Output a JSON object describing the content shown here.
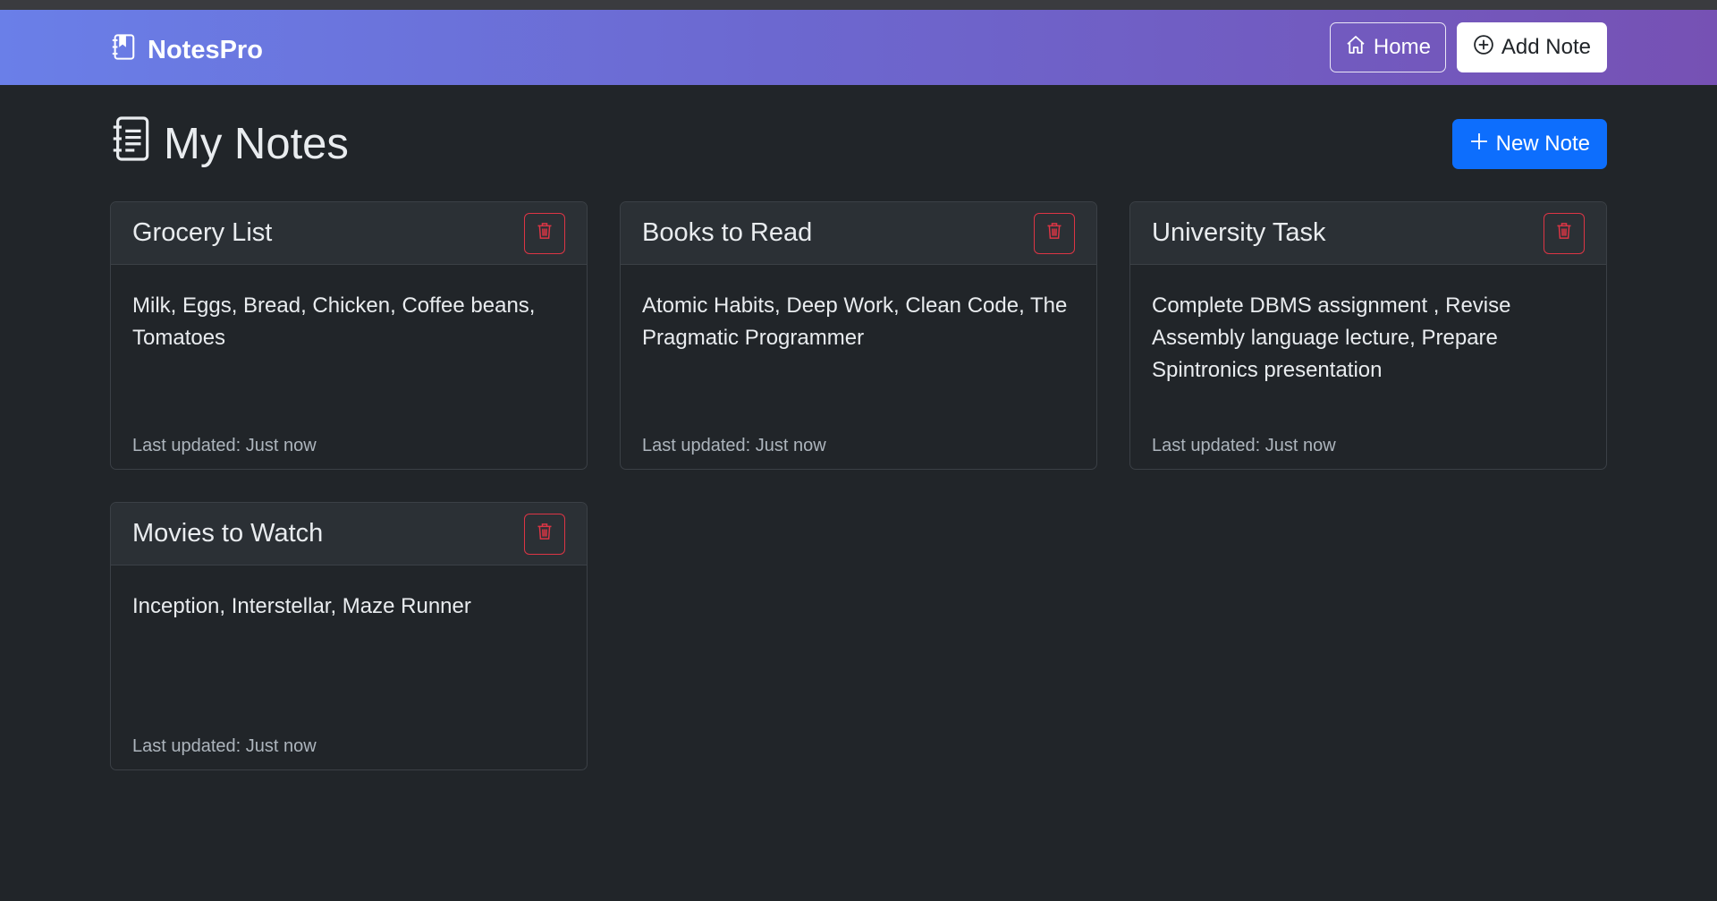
{
  "navbar": {
    "brand": "NotesPro",
    "home_label": "Home",
    "add_note_label": "Add Note"
  },
  "page": {
    "title": "My Notes",
    "new_note_label": "New Note"
  },
  "notes": [
    {
      "title": "Grocery List",
      "content": "Milk, Eggs, Bread, Chicken, Coffee beans, Tomatoes",
      "updated": "Last updated: Just now"
    },
    {
      "title": "Books to Read",
      "content": "Atomic Habits, Deep Work, Clean Code, The Pragmatic Programmer",
      "updated": "Last updated: Just now"
    },
    {
      "title": "University Task",
      "content": "Complete DBMS assignment , Revise Assembly language lecture, Prepare Spintronics presentation",
      "updated": "Last updated: Just now"
    },
    {
      "title": "Movies to Watch",
      "content": "Inception, Interstellar, Maze Runner",
      "updated": "Last updated: Just now"
    }
  ],
  "colors": {
    "background": "#212529",
    "navbar_gradient_start": "#6a7fe8",
    "navbar_gradient_end": "#7651b4",
    "primary": "#0d6efd",
    "danger": "#dc3545"
  }
}
